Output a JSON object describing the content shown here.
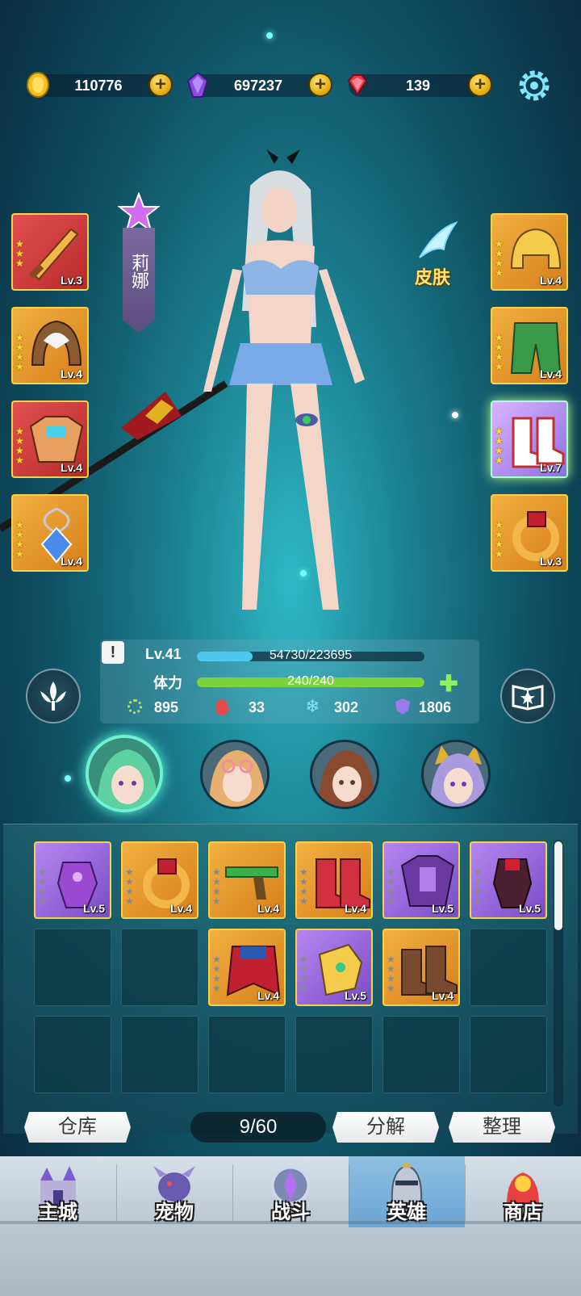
{
  "currencies": {
    "gold": {
      "value": "110776",
      "icon": "gold-coin-icon"
    },
    "diamond": {
      "value": "697237",
      "icon": "purple-crystal-icon"
    },
    "ruby": {
      "value": "139",
      "icon": "red-gem-icon"
    }
  },
  "hero": {
    "name": "莉娜",
    "skin_label": "皮肤",
    "level": "Lv.41",
    "exp_text": "54730/223695",
    "exp_fraction": 0.245,
    "stamina_label": "体力",
    "stamina_text": "240/240",
    "stamina_fraction": 1.0,
    "stats": {
      "attack": "895",
      "fire": "33",
      "ice": "302",
      "defense": "1806"
    }
  },
  "equipped_left": [
    {
      "name": "sword",
      "level": "Lv.3",
      "stars": 3,
      "rarity": "red"
    },
    {
      "name": "hood",
      "level": "Lv.4",
      "stars": 4,
      "rarity": "orange"
    },
    {
      "name": "armor",
      "level": "Lv.4",
      "stars": 4,
      "rarity": "red"
    },
    {
      "name": "amulet",
      "level": "Lv.4",
      "stars": 4,
      "rarity": "orange"
    }
  ],
  "equipped_right": [
    {
      "name": "helmet",
      "level": "Lv.4",
      "stars": 4,
      "rarity": "orange"
    },
    {
      "name": "pants",
      "level": "Lv.4",
      "stars": 4,
      "rarity": "orange"
    },
    {
      "name": "boots",
      "level": "Lv.7",
      "stars": 4,
      "rarity": "purple-glow"
    },
    {
      "name": "ring",
      "level": "Lv.3",
      "stars": 4,
      "rarity": "orange"
    }
  ],
  "inventory": {
    "row1": [
      {
        "name": "gauntlet",
        "level": "Lv.5",
        "rarity": "purple"
      },
      {
        "name": "ring",
        "level": "Lv.4",
        "rarity": "orange"
      },
      {
        "name": "gun",
        "level": "Lv.4",
        "rarity": "orange"
      },
      {
        "name": "red-boots",
        "level": "Lv.4",
        "rarity": "orange"
      },
      {
        "name": "dark-armor",
        "level": "Lv.5",
        "rarity": "purple"
      },
      {
        "name": "dark-gauntlet",
        "level": "Lv.5",
        "rarity": "purple"
      }
    ],
    "row2": [
      {
        "name": "cape",
        "level": "Lv.4",
        "rarity": "orange"
      },
      {
        "name": "gold-gauntlet",
        "level": "Lv.5",
        "rarity": "purple"
      },
      {
        "name": "brown-boots",
        "level": "Lv.4",
        "rarity": "orange"
      }
    ],
    "capacity": "9/60"
  },
  "buttons": {
    "warehouse": "仓库",
    "decompose": "分解",
    "organize": "整理"
  },
  "nav": [
    {
      "label": "主城",
      "icon": "castle-icon"
    },
    {
      "label": "宠物",
      "icon": "dragon-icon"
    },
    {
      "label": "战斗",
      "icon": "battle-crest-icon"
    },
    {
      "label": "英雄",
      "icon": "knight-helmet-icon"
    },
    {
      "label": "商店",
      "icon": "shop-icon"
    }
  ],
  "colors": {
    "accent_gold": "#f5d24a",
    "exp_bar": "#4ec8f0",
    "stamina_bar": "#7ad43a",
    "active_avatar": "#6ef2d0"
  }
}
